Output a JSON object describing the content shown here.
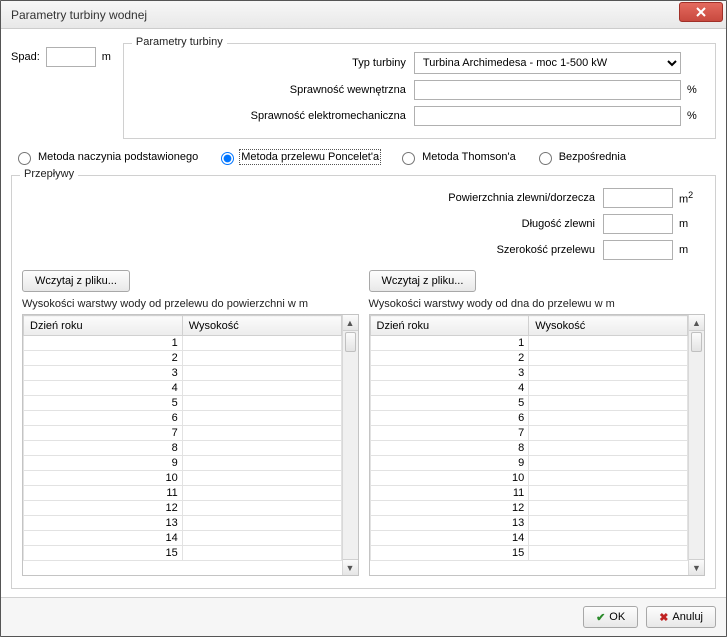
{
  "window": {
    "title": "Parametry turbiny wodnej"
  },
  "spad": {
    "label": "Spad:",
    "value": "",
    "unit": "m"
  },
  "turbineParams": {
    "legend": "Parametry turbiny",
    "type_label": "Typ turbiny",
    "type_value": "Turbina Archimedesa - moc 1-500 kW",
    "eff_internal_label": "Sprawność wewnętrzna",
    "eff_internal_value": "",
    "eff_internal_unit": "%",
    "eff_em_label": "Sprawność elektromechaniczna",
    "eff_em_value": "",
    "eff_em_unit": "%"
  },
  "methods": {
    "opt1": "Metoda naczynia podstawionego",
    "opt2": "Metoda przelewu Poncelet'a",
    "opt3": "Metoda Thomson'a",
    "opt4": "Bezpośrednia",
    "selected": 2
  },
  "flows": {
    "legend": "Przepływy",
    "area_label": "Powierzchnia zlewni/dorzecza",
    "area_value": "",
    "area_unit_base": "m",
    "area_unit_sup": "2",
    "length_label": "Długość zlewni",
    "length_value": "",
    "length_unit": "m",
    "width_label": "Szerokość przelewu",
    "width_value": "",
    "width_unit": "m",
    "load_btn": "Wczytaj z pliku...",
    "left_desc": "Wysokości warstwy wody od przelewu do powierzchni w m",
    "right_desc": "Wysokości warstwy wody od dna do przelewu w m",
    "col_day": "Dzień roku",
    "col_height": "Wysokość",
    "rows": [
      "1",
      "2",
      "3",
      "4",
      "5",
      "6",
      "7",
      "8",
      "9",
      "10",
      "11",
      "12",
      "13",
      "14",
      "15"
    ]
  },
  "footer": {
    "ok": "OK",
    "cancel": "Anuluj"
  }
}
